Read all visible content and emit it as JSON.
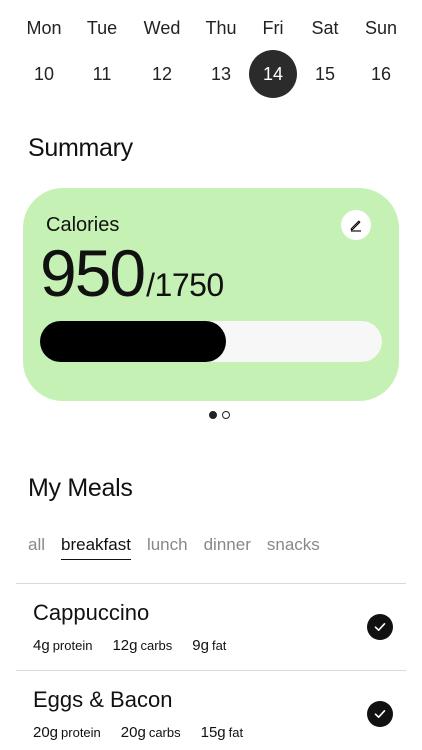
{
  "week": [
    {
      "day": "Mon",
      "date": "10"
    },
    {
      "day": "Tue",
      "date": "11"
    },
    {
      "day": "Wed",
      "date": "12"
    },
    {
      "day": "Thu",
      "date": "13"
    },
    {
      "day": "Fri",
      "date": "14",
      "selected": true
    },
    {
      "day": "Sat",
      "date": "15"
    },
    {
      "day": "Sun",
      "date": "16"
    }
  ],
  "summary": {
    "title": "Summary",
    "card": {
      "label": "Calories",
      "current": "950",
      "target": "/1750",
      "progress": 0.543,
      "card_color": "#c6f1b4",
      "edit_icon": "pencil-icon"
    },
    "pager": {
      "pages": 2,
      "active": 0
    }
  },
  "meals": {
    "title": "My Meals",
    "tabs": [
      "all",
      "breakfast",
      "lunch",
      "dinner",
      "snacks"
    ],
    "active_tab": "breakfast",
    "items": [
      {
        "name": "Cappuccino",
        "protein_value": "4g",
        "protein_label": "protein",
        "carbs_value": "12g",
        "carbs_label": "carbs",
        "fat_value": "9g",
        "fat_label": "fat",
        "checked": true
      },
      {
        "name": "Eggs & Bacon",
        "protein_value": "20g",
        "protein_label": "protein",
        "carbs_value": "20g",
        "carbs_label": "carbs",
        "fat_value": "15g",
        "fat_label": "fat",
        "checked": true
      }
    ]
  }
}
